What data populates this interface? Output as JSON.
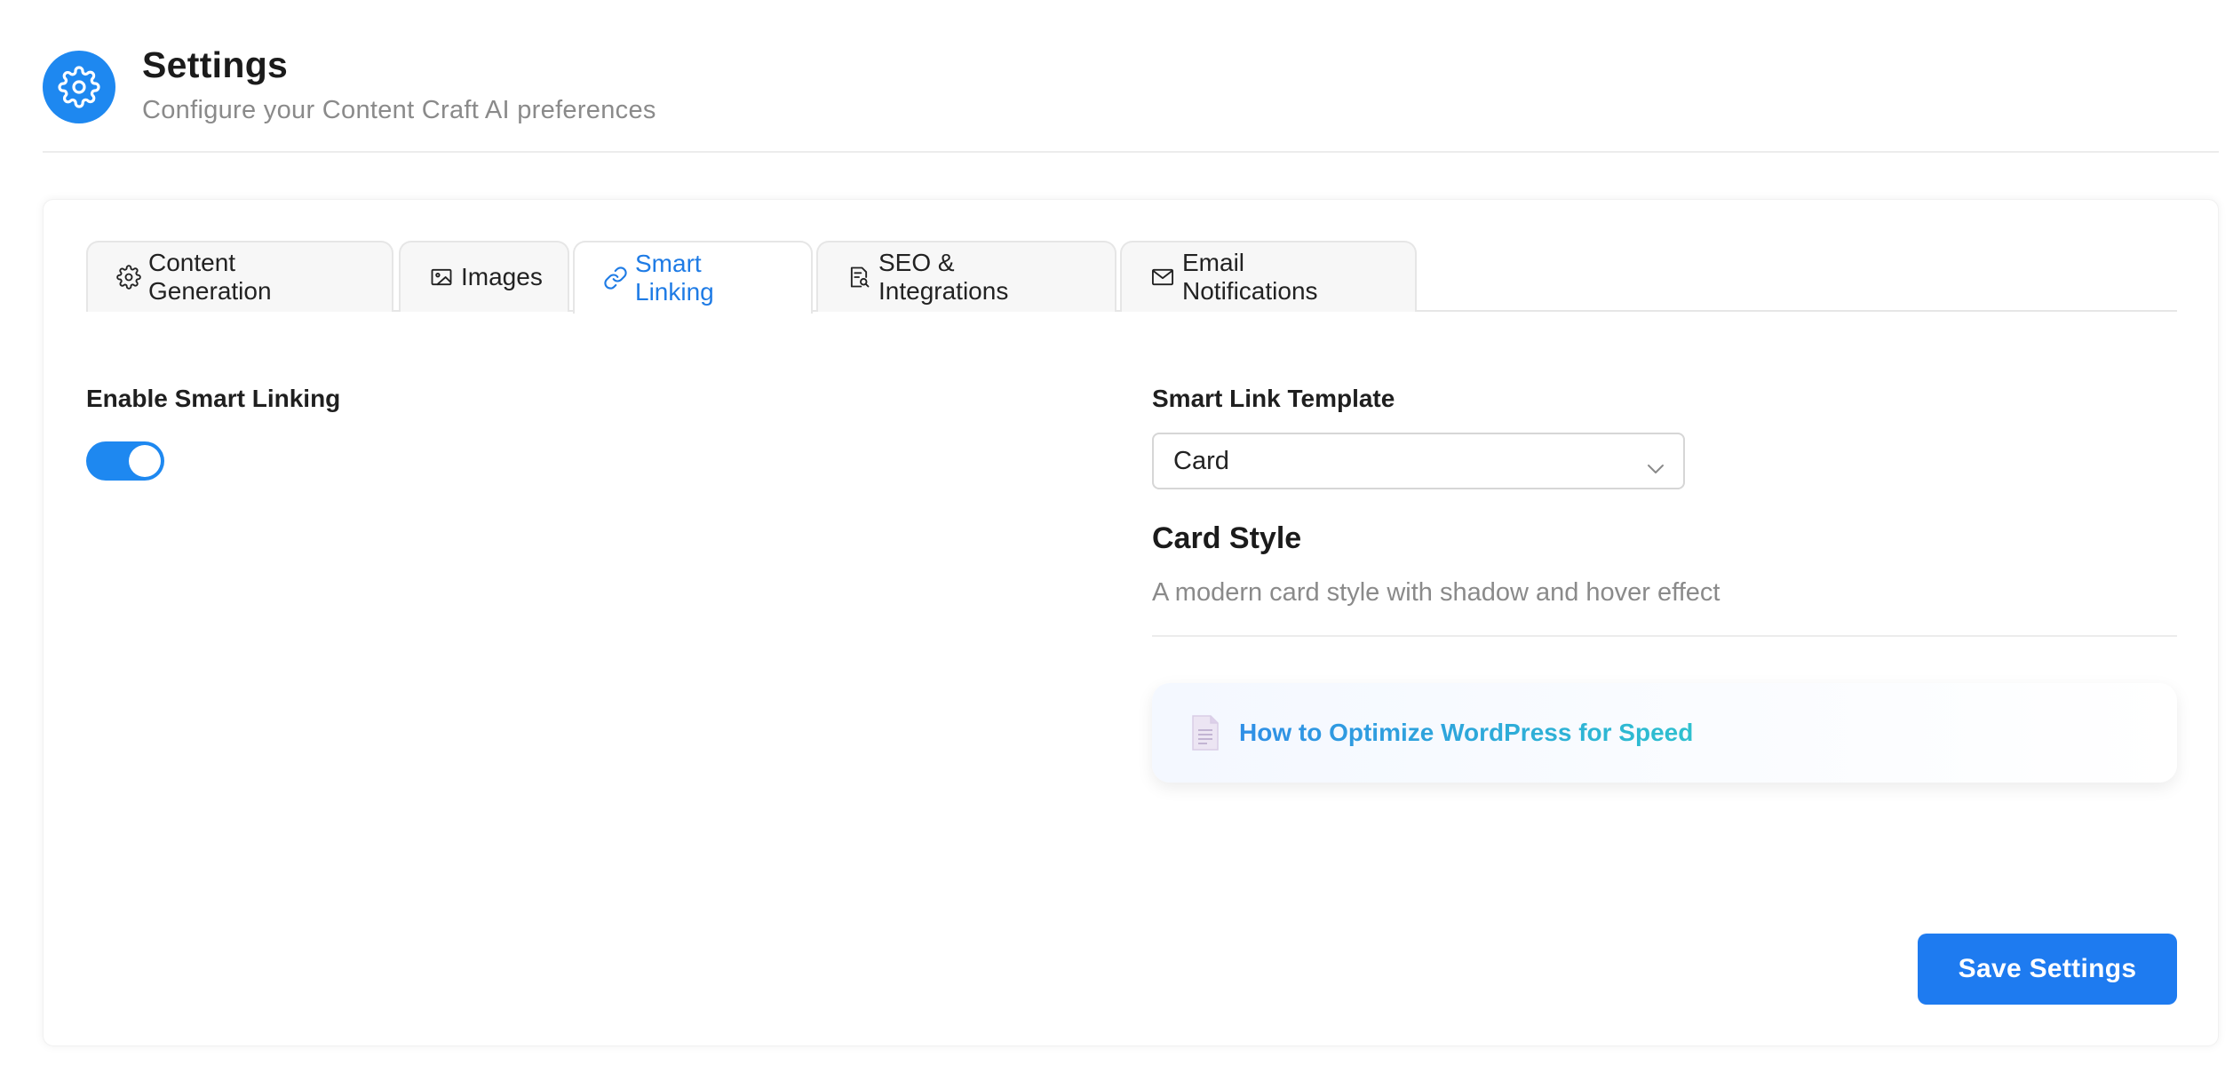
{
  "header": {
    "title": "Settings",
    "subtitle": "Configure your Content Craft AI preferences",
    "icon": "gear-icon",
    "accent_color": "#1e88f0"
  },
  "tabs": [
    {
      "label": "Content Generation",
      "icon": "gear-icon",
      "active": false
    },
    {
      "label": "Images",
      "icon": "image-icon",
      "active": false
    },
    {
      "label": "Smart Linking",
      "icon": "link-icon",
      "active": true
    },
    {
      "label": "SEO & Integrations",
      "icon": "search-document-icon",
      "active": false
    },
    {
      "label": "Email Notifications",
      "icon": "mail-icon",
      "active": false
    }
  ],
  "smart_linking": {
    "enable_label": "Enable Smart Linking",
    "enabled": true,
    "template_label": "Smart Link Template",
    "template_value": "Card",
    "style_title": "Card Style",
    "style_description": "A modern card style with shadow and hover effect",
    "preview_link_text": "How to Optimize WordPress for Speed",
    "preview_icon": "document-icon"
  },
  "actions": {
    "save_label": "Save Settings"
  }
}
